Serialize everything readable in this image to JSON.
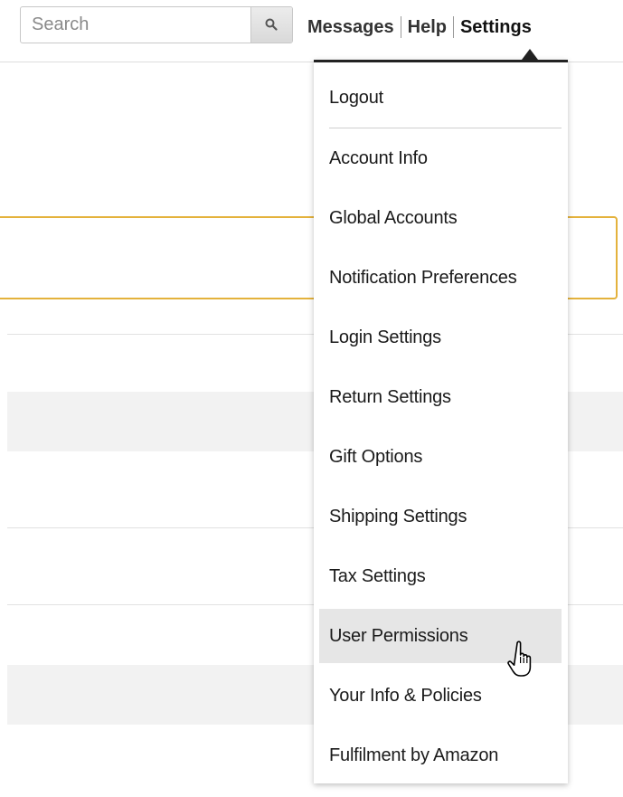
{
  "search": {
    "placeholder": "Search",
    "value": ""
  },
  "top_nav": {
    "messages": "Messages",
    "help": "Help",
    "settings": "Settings"
  },
  "settings_menu": {
    "items": [
      {
        "label": "Logout"
      },
      {
        "label": "Account Info"
      },
      {
        "label": "Global Accounts"
      },
      {
        "label": "Notification Preferences"
      },
      {
        "label": "Login Settings"
      },
      {
        "label": "Return Settings"
      },
      {
        "label": "Gift Options"
      },
      {
        "label": "Shipping Settings"
      },
      {
        "label": "Tax Settings"
      },
      {
        "label": "User Permissions",
        "hovered": true
      },
      {
        "label": "Your Info & Policies"
      },
      {
        "label": "Fulfilment by Amazon"
      }
    ]
  },
  "colors": {
    "notice_border": "#e4b23c",
    "menu_hover": "#e6e6e6",
    "menu_top_border": "#222222"
  },
  "icons": {
    "search_button": "magnifier-icon",
    "pointer": "hand-pointer-icon"
  }
}
